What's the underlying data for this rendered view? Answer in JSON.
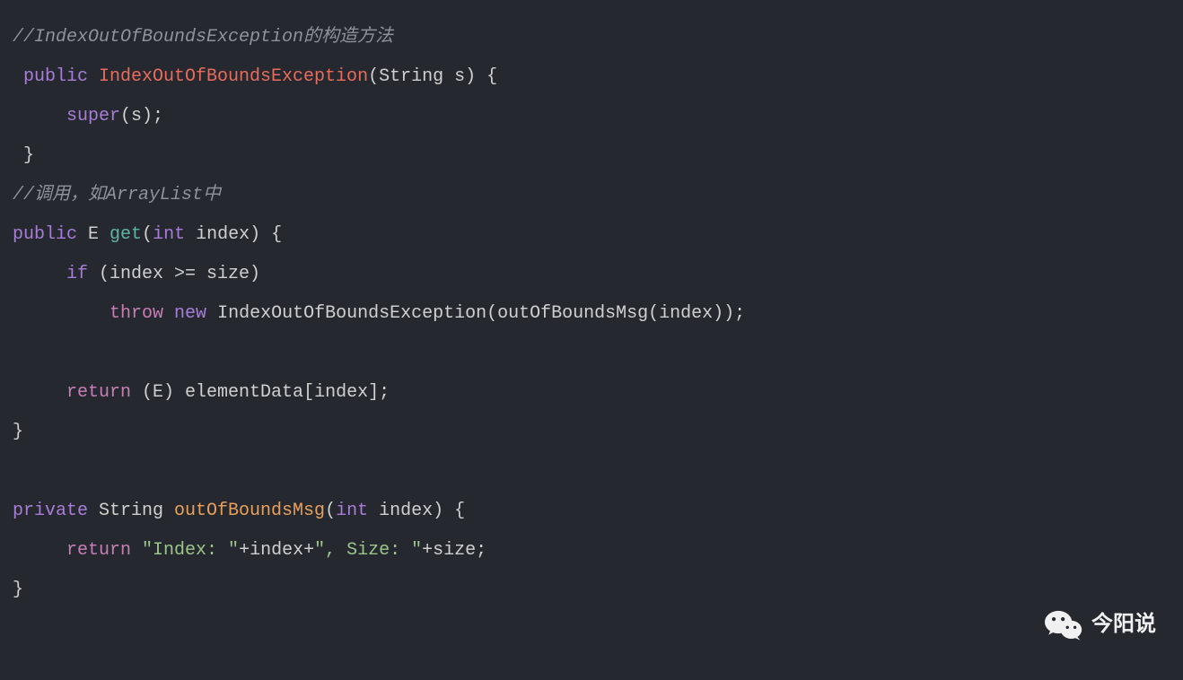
{
  "code": {
    "line1_comment": "//IndexOutOfBoundsException的构造方法",
    "line2_public": " public ",
    "line2_class": "IndexOutOfBoundsException",
    "line2_paren_open": "(",
    "line2_type_string": "String",
    "line2_param": " s",
    "line2_paren_close": ")",
    "line2_brace": " {",
    "line3_indent": "     ",
    "line3_super": "super",
    "line3_call": "(s);",
    "line4_brace": " }",
    "line5_comment": "//调用，如ArrayList中",
    "line6_public": "public ",
    "line6_E": "E ",
    "line6_method": "get",
    "line6_paren_open": "(",
    "line6_int": "int",
    "line6_param": " index",
    "line6_paren_close": ")",
    "line6_brace": " {",
    "line7_indent": "     ",
    "line7_if": "if",
    "line7_cond": " (index >= size)",
    "line8_indent": "         ",
    "line8_throw": "throw ",
    "line8_new": "new ",
    "line8_exc": "IndexOutOfBoundsException(outOfBoundsMsg(index));",
    "line9_blank": "",
    "line10_indent": "     ",
    "line10_return": "return",
    "line10_rest": " (E) elementData[index];",
    "line11_brace": "}",
    "line12_blank": "",
    "line13_private": "private ",
    "line13_string": "String ",
    "line13_method": "outOfBoundsMsg",
    "line13_paren_open": "(",
    "line13_int": "int",
    "line13_param": " index",
    "line13_paren_close": ")",
    "line13_brace": " {",
    "line14_indent": "     ",
    "line14_return": "return ",
    "line14_str1": "\"Index: \"",
    "line14_plus1": "+index+",
    "line14_str2": "\", Size: \"",
    "line14_plus2": "+size;",
    "line15_brace": "}"
  },
  "watermark": {
    "text": "今阳说"
  }
}
